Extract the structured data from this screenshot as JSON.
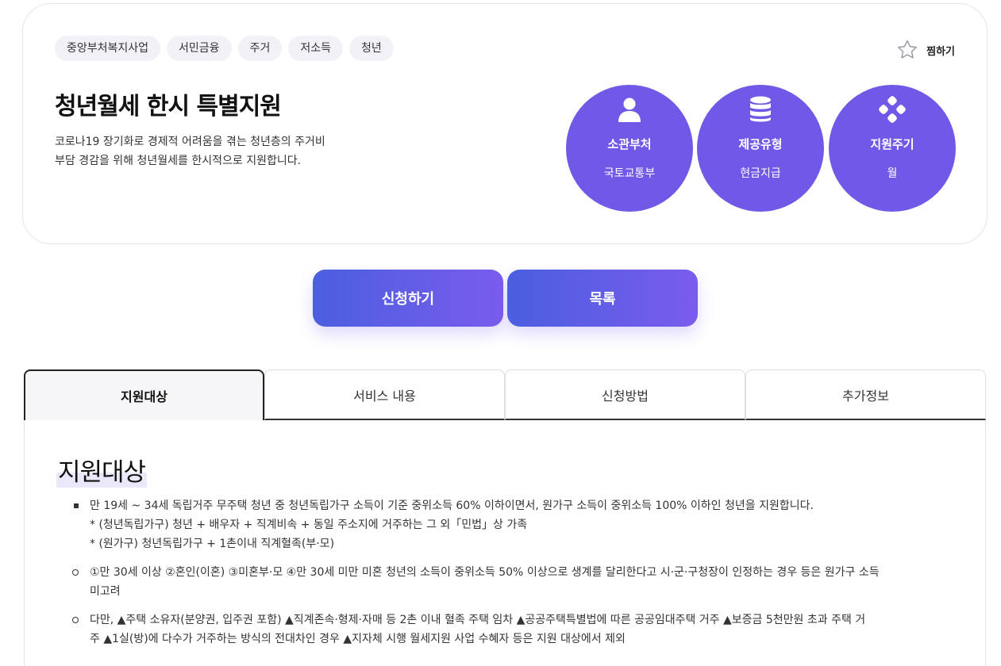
{
  "tags": [
    "중앙부처복지사업",
    "서민금융",
    "주거",
    "저소득",
    "청년"
  ],
  "favorite": {
    "label": "찜하기",
    "icon": "star-outline-icon"
  },
  "title": "청년월세 한시 특별지원",
  "description": [
    "코로나19 장기화로 경제적 어려움을 겪는 청년층의 주거비",
    "부담 경감을 위해 청년월세를 한시적으로 지원합니다."
  ],
  "info": [
    {
      "label": "소관부처",
      "value": "국토교통부",
      "icon": "person-icon"
    },
    {
      "label": "제공유형",
      "value": "현금지급",
      "icon": "database-icon"
    },
    {
      "label": "지원주기",
      "value": "월",
      "icon": "dots-cluster-icon"
    }
  ],
  "accent_color": "#7158e6",
  "buttons": {
    "apply": "신청하기",
    "list": "목록"
  },
  "tabs": [
    "지원대상",
    "서비스 내용",
    "신청방법",
    "추가정보"
  ],
  "active_tab": "지원대상",
  "section": {
    "title": "지원대상",
    "items": [
      {
        "marker": "square",
        "lines": [
          "만 19세 ~ 34세 독립거주 무주택 청년 중 청년독립가구 소득이 기준 중위소득 60% 이하이면서, 원가구 소득이 중위소득 100% 이하인 청년을 지원합니다.",
          "* (청년독립가구) 청년 + 배우자 + 직계비속 + 동일 주소지에 거주하는 그 외「민법」상 가족",
          "* (원가구) 청년독립가구 + 1촌이내 직계혈족(부·모)"
        ]
      },
      {
        "marker": "circle",
        "lines": [
          "①만 30세 이상 ②혼인(이혼) ③미혼부·모 ④만 30세 미만 미혼 청년의 소득이 중위소득 50% 이상으로 생계를 달리한다고 시·군·구청장이 인정하는 경우 등은 원가구 소득",
          "미고려"
        ]
      },
      {
        "marker": "circle",
        "lines": [
          "다만, ▲주택 소유자(분양권, 입주권 포함) ▲직계존속·형제·자매 등 2촌 이내 혈족 주택 임차 ▲공공주택특별법에 따른 공공임대주택 거주 ▲보증금 5천만원 초과 주택 거",
          "주 ▲1실(방)에 다수가 거주하는 방식의 전대차인 경우 ▲지자체 시행 월세지원 사업 수혜자 등은 지원 대상에서 제외"
        ]
      }
    ]
  }
}
